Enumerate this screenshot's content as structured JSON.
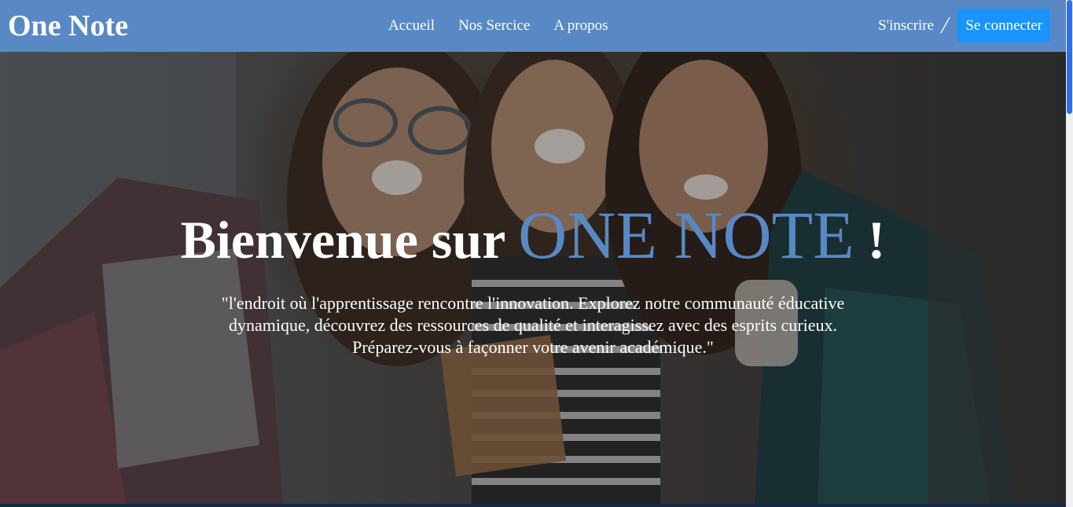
{
  "navbar": {
    "brand": "One Note",
    "links": [
      "Accueil",
      "Nos Sercice",
      "A propos"
    ],
    "signup_label": "S'inscrire",
    "separator": "/",
    "login_label": "Se connecter",
    "background_color": "#5889c4",
    "login_color": "#1a94fb"
  },
  "hero": {
    "title_prefix": "Bienvenue sur",
    "title_brand": "ONE NOTE",
    "title_suffix": "!",
    "text": "\"l'endroit où l'apprentissage rencontre l'innovation. Explorez notre communauté éducative dynamique, découvrez des ressources de qualité et interagissez avec des esprits curieux. Préparez-vous à façonner votre avenir académique.\"",
    "brand_color": "#5889c4"
  }
}
